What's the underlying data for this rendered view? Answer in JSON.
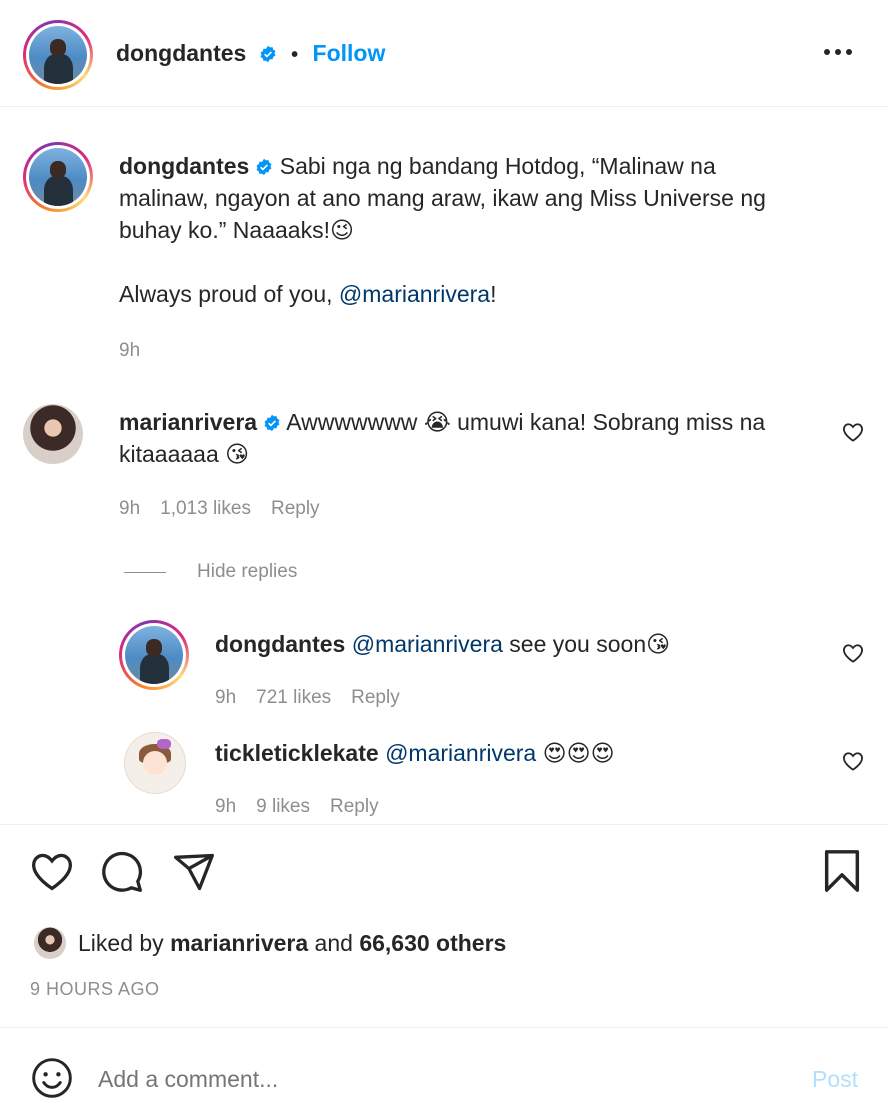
{
  "header": {
    "username": "dongdantes",
    "dot": "•",
    "follow_label": "Follow",
    "more_icon": "more-options-icon"
  },
  "caption": {
    "username": "dongdantes",
    "text_line1": "Sabi nga ng bandang Hotdog, “Malinaw na",
    "text_line2": "malinaw, ngayon at ano mang araw, ikaw ang Miss Universe ng",
    "text_line3": "buhay ko.” Naaaaks!",
    "emoji": "😉",
    "text_line4_prefix": "Always proud of you, ",
    "mention": "@marianrivera",
    "text_line4_suffix": "!",
    "time": "9h"
  },
  "comments": [
    {
      "username": "marianrivera",
      "text_part1": "Awwwwwww",
      "emoji1": "😭",
      "text_part2": "umuwi kana! Sobrang miss na",
      "text_line2": "kitaaaaaa",
      "emoji2": "😘",
      "time": "9h",
      "likes": "1,013 likes",
      "reply_label": "Reply",
      "hide_replies_label": "Hide replies",
      "replies": [
        {
          "username": "dongdantes",
          "mention": "@marianrivera",
          "text": "see you soon",
          "emoji": "😘",
          "time": "9h",
          "likes": "721 likes",
          "reply_label": "Reply"
        },
        {
          "username": "tickleticklekate",
          "mention": "@marianrivera",
          "emoji": "😍😍😍",
          "time": "9h",
          "likes": "9 likes",
          "reply_label": "Reply"
        }
      ]
    }
  ],
  "actions": {
    "like_icon": "heart-icon",
    "comment_icon": "comment-icon",
    "share_icon": "share-icon",
    "save_icon": "bookmark-icon"
  },
  "likes": {
    "prefix": "Liked by ",
    "user": "marianrivera",
    "middle": " and ",
    "others": "66,630 others"
  },
  "timestamp": "9 HOURS AGO",
  "comment_box": {
    "placeholder": "Add a comment...",
    "post_label": "Post",
    "emoji_icon": "smiley-icon"
  },
  "colors": {
    "link_blue": "#0095f6",
    "mention_navy": "#00376b",
    "verified_blue": "#0095f6",
    "post_disabled": "#b2dffc"
  }
}
